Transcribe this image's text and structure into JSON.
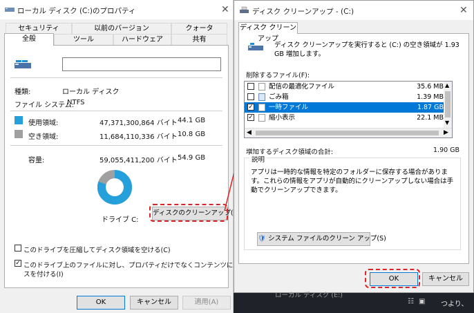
{
  "left_window": {
    "title": "ローカル ディスク (C:)のプロパティ",
    "tabs_row1": [
      "セキュリティ",
      "以前のバージョン",
      "クォータ"
    ],
    "tabs_row2": [
      "全般",
      "ツール",
      "ハードウェア",
      "共有"
    ],
    "active_tab": "全般",
    "name_value": "",
    "type_label": "種類:",
    "type_value": "ローカル ディスク",
    "fs_label": "ファイル システム:",
    "fs_value": "NTFS",
    "used_label": "使用領域:",
    "used_bytes": "47,371,300,864 バイト",
    "used_gb": "44.1 GB",
    "free_label": "空き領域:",
    "free_bytes": "11,684,110,336 バイト",
    "free_gb": "10.8 GB",
    "capacity_label": "容量:",
    "capacity_bytes": "59,055,411,200 バイト",
    "capacity_gb": "54.9 GB",
    "drive_label": "ドライブ C:",
    "cleanup_button": "ディスクのクリーンアップ(D)",
    "compress_label": "このドライブを圧縮してディスク領域を空ける(C)",
    "compress_checked": false,
    "index_label_line1": "このドライブ上のファイルに対し、プロパティだけでなくコンテンツにもインデック",
    "index_label_line2": "スを付ける(I)",
    "index_checked": true,
    "ok_button": "OK",
    "cancel_button": "キャンセル",
    "apply_button": "適用(A)",
    "used_fraction": 0.802,
    "colors": {
      "used": "#26a0da",
      "free": "#a0a0a0"
    }
  },
  "right_window": {
    "title": "ディスク クリーンアップ - (C:)",
    "tab": "ディスク クリーンアップ",
    "description": "ディスク クリーンアップを実行すると (C:) の空き領域が 1.93 GB 増加します。",
    "files_label": "削除するファイル(F):",
    "files": [
      {
        "name": "配信の最適化ファイル",
        "size": "35.6 MB",
        "checked": false,
        "selected": false
      },
      {
        "name": "ごみ箱",
        "size": "1.39 MB",
        "checked": false,
        "selected": false
      },
      {
        "name": "一時ファイル",
        "size": "1.87 GB",
        "checked": true,
        "selected": true
      },
      {
        "name": "縮小表示",
        "size": "22.1 MB",
        "checked": true,
        "selected": false
      }
    ],
    "total_label": "増加するディスク領域の合計:",
    "total_value": "1.90 GB",
    "description_heading": "説明",
    "description_text": "アプリは一時的な情報を特定のフォルダーに保存する場合があります。これらの情報をアプリが自動的にクリーンアップしない場合は手動でクリーンアップできます。",
    "system_cleanup_button": "システム ファイルのクリーン アップ(S)",
    "ok_button": "OK",
    "cancel_button": "キャンセル"
  },
  "taskbar": {
    "text": "ローカル ディスク (E:)",
    "right_text": "つより、"
  },
  "highlight_color": "#e02020"
}
